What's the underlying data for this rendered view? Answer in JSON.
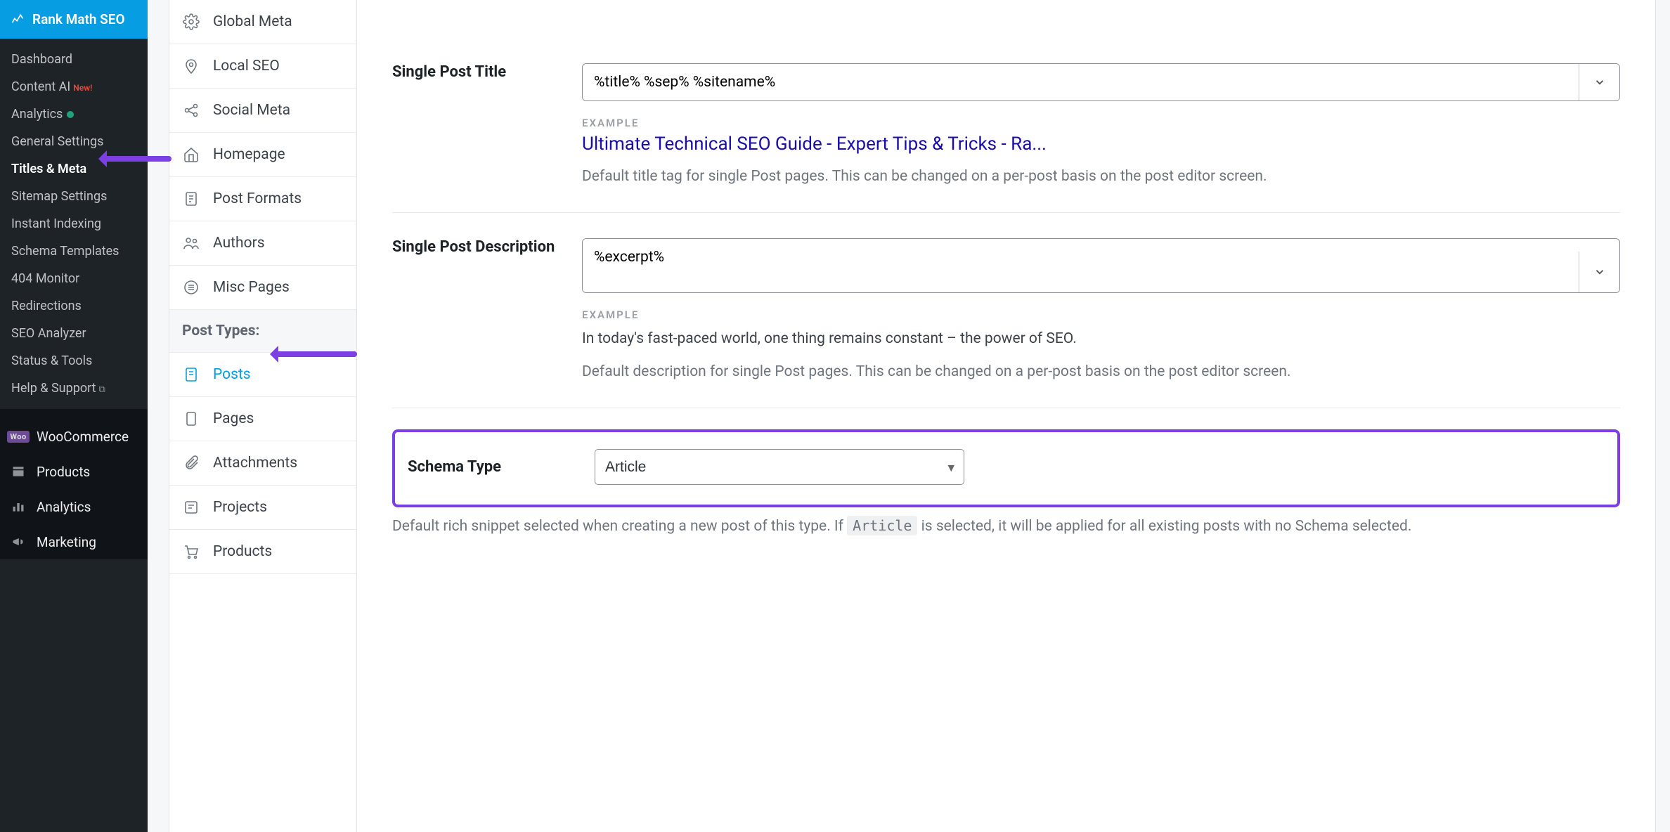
{
  "brand": {
    "title": "Rank Math SEO"
  },
  "wp_submenu": [
    {
      "label": "Dashboard",
      "key": "dashboard"
    },
    {
      "label": "Content AI",
      "key": "content-ai",
      "new": true
    },
    {
      "label": "Analytics",
      "key": "analytics",
      "dot": true
    },
    {
      "label": "General Settings",
      "key": "general-settings"
    },
    {
      "label": "Titles & Meta",
      "key": "titles-meta",
      "active": true
    },
    {
      "label": "Sitemap Settings",
      "key": "sitemap"
    },
    {
      "label": "Instant Indexing",
      "key": "instant-indexing"
    },
    {
      "label": "Schema Templates",
      "key": "schema-templates"
    },
    {
      "label": "404 Monitor",
      "key": "404-monitor"
    },
    {
      "label": "Redirections",
      "key": "redirections"
    },
    {
      "label": "SEO Analyzer",
      "key": "seo-analyzer"
    },
    {
      "label": "Status & Tools",
      "key": "status-tools"
    },
    {
      "label": "Help & Support",
      "key": "help-support",
      "ext": true
    }
  ],
  "wp_main": [
    {
      "label": "WooCommerce",
      "key": "woocommerce",
      "icon": "woo"
    },
    {
      "label": "Products",
      "key": "products",
      "icon": "archive"
    },
    {
      "label": "Analytics",
      "key": "analytics",
      "icon": "bars"
    },
    {
      "label": "Marketing",
      "key": "marketing",
      "icon": "megaphone"
    }
  ],
  "sec_nav": {
    "group1": [
      {
        "label": "Global Meta",
        "icon": "gear",
        "key": "global-meta"
      },
      {
        "label": "Local SEO",
        "icon": "pin",
        "key": "local-seo"
      },
      {
        "label": "Social Meta",
        "icon": "share",
        "key": "social-meta"
      },
      {
        "label": "Homepage",
        "icon": "home",
        "key": "homepage"
      },
      {
        "label": "Post Formats",
        "icon": "doc",
        "key": "post-formats"
      },
      {
        "label": "Authors",
        "icon": "users",
        "key": "authors"
      },
      {
        "label": "Misc Pages",
        "icon": "list",
        "key": "misc-pages"
      }
    ],
    "post_types_heading": "Post Types:",
    "group2": [
      {
        "label": "Posts",
        "icon": "post",
        "key": "posts",
        "active": true
      },
      {
        "label": "Pages",
        "icon": "page",
        "key": "pages"
      },
      {
        "label": "Attachments",
        "icon": "clip",
        "key": "attachments"
      },
      {
        "label": "Projects",
        "icon": "project",
        "key": "projects"
      },
      {
        "label": "Products",
        "icon": "cart",
        "key": "products"
      }
    ]
  },
  "fields": {
    "single_post_title": {
      "label": "Single Post Title",
      "value": "%title% %sep% %sitename%",
      "example_heading": "EXAMPLE",
      "example_link": "Ultimate Technical SEO Guide - Expert Tips & Tricks - Ra...",
      "help": "Default title tag for single Post pages. This can be changed on a per-post basis on the post editor screen."
    },
    "single_post_description": {
      "label": "Single Post Description",
      "value": "%excerpt%",
      "example_heading": "EXAMPLE",
      "example_text": "In today's fast-paced world, one thing remains constant – the power of SEO.",
      "help": "Default description for single Post pages. This can be changed on a per-post basis on the post editor screen."
    },
    "schema_type": {
      "label": "Schema Type",
      "value": "Article",
      "help_pre": "Default rich snippet selected when creating a new post of this type. If ",
      "help_code": "Article",
      "help_post": " is selected, it will be applied for all existing posts with no Schema selected."
    }
  },
  "badges": {
    "new": "New!"
  }
}
